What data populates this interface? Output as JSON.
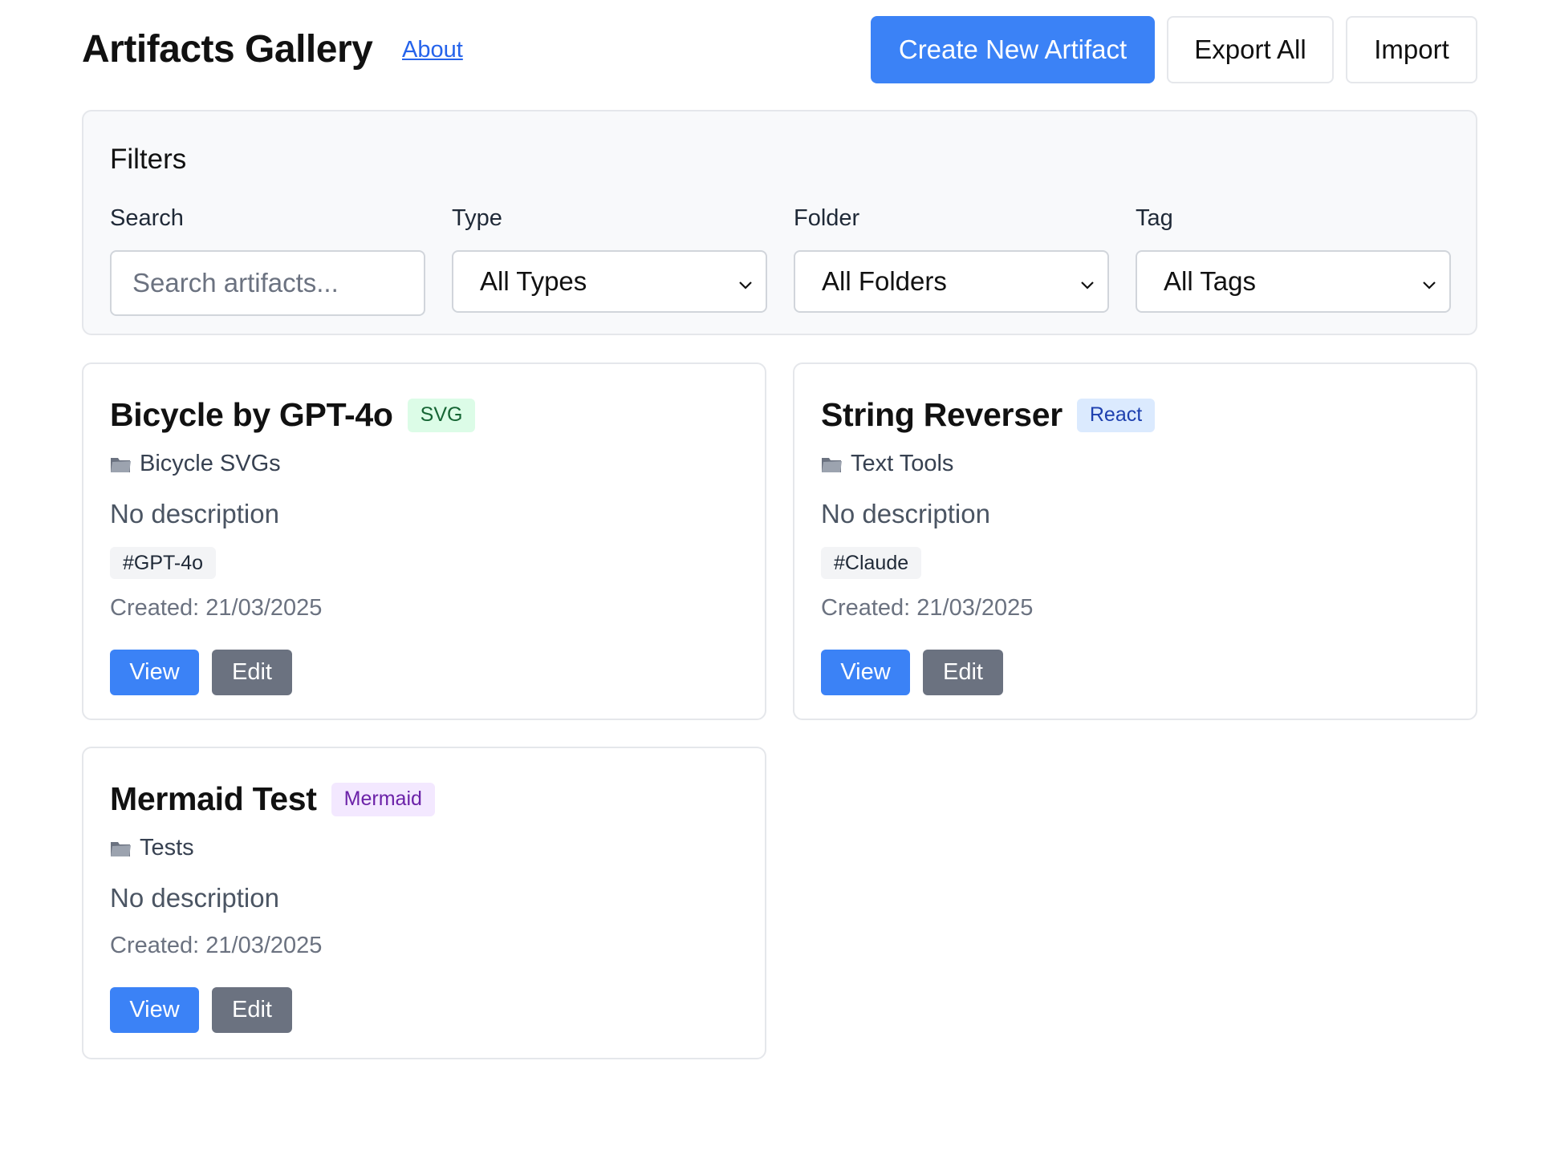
{
  "header": {
    "title": "Artifacts Gallery",
    "about_link": "About",
    "create_label": "Create New Artifact",
    "export_label": "Export All",
    "import_label": "Import"
  },
  "filters": {
    "title": "Filters",
    "search": {
      "label": "Search",
      "placeholder": "Search artifacts..."
    },
    "type": {
      "label": "Type",
      "selected": "All Types"
    },
    "folder": {
      "label": "Folder",
      "selected": "All Folders"
    },
    "tag": {
      "label": "Tag",
      "selected": "All Tags"
    }
  },
  "cards": [
    {
      "title": "Bicycle by GPT-4o",
      "badge": "SVG",
      "folder": "Bicycle SVGs",
      "description": "No description",
      "tag": "#GPT-4o",
      "created": "Created: 21/03/2025",
      "view_label": "View",
      "edit_label": "Edit"
    },
    {
      "title": "String Reverser",
      "badge": "React",
      "folder": "Text Tools",
      "description": "No description",
      "tag": "#Claude",
      "created": "Created: 21/03/2025",
      "view_label": "View",
      "edit_label": "Edit"
    },
    {
      "title": "Mermaid Test",
      "badge": "Mermaid",
      "folder": "Tests",
      "description": "No description",
      "created": "Created: 21/03/2025",
      "view_label": "View",
      "edit_label": "Edit"
    }
  ],
  "colors": {
    "primary": "#3b82f6",
    "secondary": "#6b7280",
    "badge_svg_bg": "#dcfce7",
    "badge_svg_fg": "#166534",
    "badge_react_bg": "#dbeafe",
    "badge_react_fg": "#1e40af",
    "badge_mermaid_bg": "#f3e8ff",
    "badge_mermaid_fg": "#6b21a8"
  },
  "icons": {
    "folder": "folder-icon",
    "select_caret": "chevron-down-icon"
  }
}
